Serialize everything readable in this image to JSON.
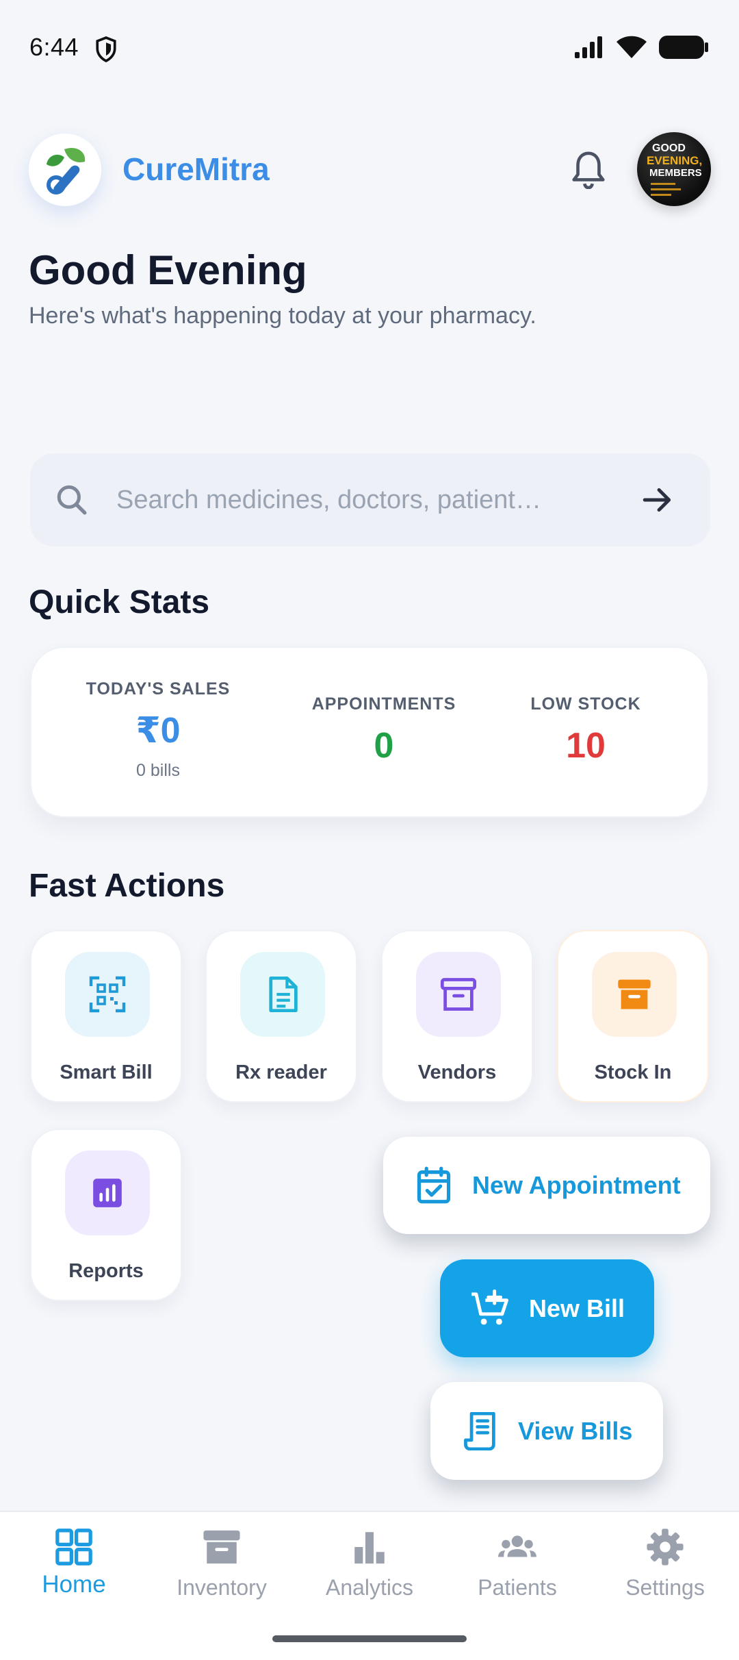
{
  "status_bar": {
    "time": "6:44"
  },
  "header": {
    "app_name": "CureMitra",
    "greeting": "Good Evening",
    "subtitle": "Here's what's happening today at your pharmacy.",
    "avatar_text": [
      "GOOD",
      "EVENING,",
      "MEMBERS"
    ]
  },
  "search": {
    "placeholder": "Search medicines, doctors, patient…"
  },
  "quick_stats": {
    "title": "Quick Stats",
    "today_sales": {
      "label": "TODAY'S SALES",
      "value": "₹0",
      "sub": "0 bills"
    },
    "appointments": {
      "label": "APPOINTMENTS",
      "value": "0"
    },
    "low_stock": {
      "label": "LOW STOCK",
      "value": "10"
    },
    "colors": {
      "sales": "#3b8de6",
      "appointments": "#21a147",
      "low_stock": "#e03a3a"
    }
  },
  "fast_actions": {
    "title": "Fast Actions",
    "items": [
      {
        "label": "Smart Bill",
        "icon": "qr-scan-icon"
      },
      {
        "label": "Rx reader",
        "icon": "document-icon"
      },
      {
        "label": "Vendors",
        "icon": "archive-box-icon"
      },
      {
        "label": "Stock In",
        "icon": "archive-box-icon"
      },
      {
        "label": "Reports",
        "icon": "bar-chart-icon"
      }
    ]
  },
  "fab_menu": {
    "new_appointment": "New Appointment",
    "new_bill": "New Bill",
    "view_bills": "View Bills"
  },
  "bottom_nav": {
    "items": [
      {
        "label": "Home",
        "icon": "grid-icon",
        "active": true
      },
      {
        "label": "Inventory",
        "icon": "archive-box-icon",
        "active": false
      },
      {
        "label": "Analytics",
        "icon": "bar-chart-icon",
        "active": false
      },
      {
        "label": "Patients",
        "icon": "people-icon",
        "active": false
      },
      {
        "label": "Settings",
        "icon": "gear-icon",
        "active": false
      }
    ]
  },
  "theme": {
    "accent": "#13a3e6",
    "brand": "#3b8de6"
  }
}
